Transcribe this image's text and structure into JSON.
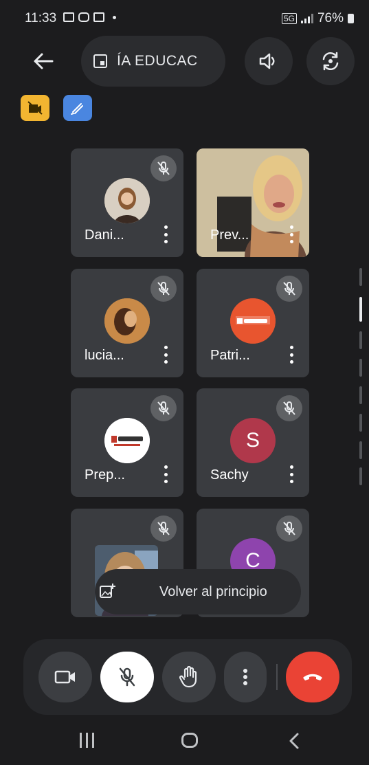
{
  "status_bar": {
    "time": "11:33",
    "network": "5G",
    "battery": "76%"
  },
  "top_bar": {
    "meeting_title": "ÍA EDUCAC"
  },
  "participants": [
    {
      "name": "Dani...",
      "avatar_type": "photo",
      "muted": true
    },
    {
      "name": "Prev...",
      "avatar_type": "video",
      "muted": false
    },
    {
      "name": "lucia...",
      "avatar_type": "photo",
      "muted": true
    },
    {
      "name": "Patri...",
      "avatar_type": "logo",
      "muted": true
    },
    {
      "name": "Prep...",
      "avatar_type": "logo",
      "muted": true
    },
    {
      "name": "Sachy",
      "avatar_type": "initial",
      "initial": "S",
      "color": "#b0384b",
      "muted": true
    },
    {
      "name": "",
      "avatar_type": "video",
      "muted": true
    },
    {
      "name": "",
      "avatar_type": "initial",
      "initial": "C",
      "color": "#8e44ad",
      "muted": true
    }
  ],
  "return_to_top": {
    "label": "Volver al principio"
  },
  "colors": {
    "background": "#1c1c1e",
    "tile": "#3a3c40",
    "end_call": "#ea4335",
    "chip_yellow": "#f2b531",
    "chip_blue": "#4a86e0"
  }
}
